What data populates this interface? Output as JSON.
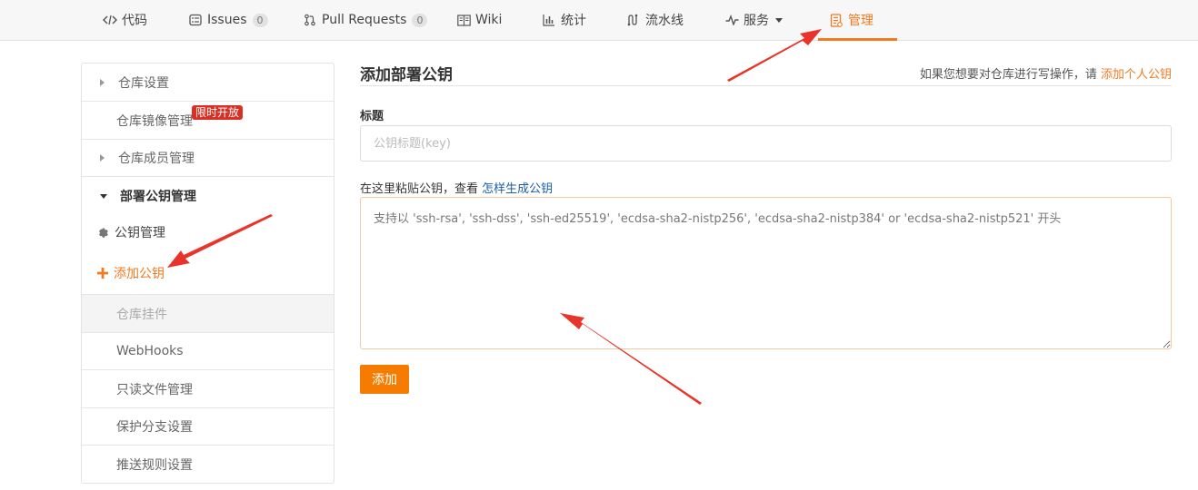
{
  "nav": {
    "tabs": [
      {
        "label": "代码",
        "icon": "code-icon"
      },
      {
        "label": "Issues",
        "count": "0",
        "icon": "issues-icon"
      },
      {
        "label": "Pull Requests",
        "count": "0",
        "icon": "pull-request-icon"
      },
      {
        "label": "Wiki",
        "icon": "wiki-icon"
      },
      {
        "label": "统计",
        "icon": "chart-icon"
      },
      {
        "label": "流水线",
        "icon": "pipeline-icon"
      },
      {
        "label": "服务",
        "icon": "pulse-icon"
      },
      {
        "label": "管理",
        "icon": "manage-icon",
        "active": true
      }
    ],
    "active_color": "#f17a21"
  },
  "sidebar": {
    "items": [
      {
        "label": "仓库设置"
      },
      {
        "label": "仓库镜像管理",
        "badge": "限时开放"
      },
      {
        "label": "仓库成员管理"
      },
      {
        "label": "部署公钥管理"
      },
      {
        "label": "公钥管理"
      },
      {
        "label": "添加公钥"
      },
      {
        "label": "仓库挂件"
      },
      {
        "label": "WebHooks"
      },
      {
        "label": "只读文件管理"
      },
      {
        "label": "保护分支设置"
      },
      {
        "label": "推送规则设置"
      }
    ]
  },
  "main": {
    "title": "添加部署公钥",
    "hint_text": "如果您想要对仓库进行写操作，请",
    "hint_link": "添加个人公钥",
    "title_label": "标题",
    "title_placeholder": "公钥标题(key)",
    "key_label": "在这里粘贴公钥，查看",
    "key_link": "怎样生成公钥",
    "key_placeholder": "支持以 'ssh-rsa', 'ssh-dss', 'ssh-ed25519', 'ecdsa-sha2-nistp256', 'ecdsa-sha2-nistp384' or 'ecdsa-sha2-nistp521' 开头",
    "submit_label": "添加"
  },
  "colors": {
    "accent": "#f17a21",
    "button": "#f57c00",
    "badge": "#d93025",
    "link": "#1a5ea8",
    "annotation_arrow": "#e8342a"
  }
}
